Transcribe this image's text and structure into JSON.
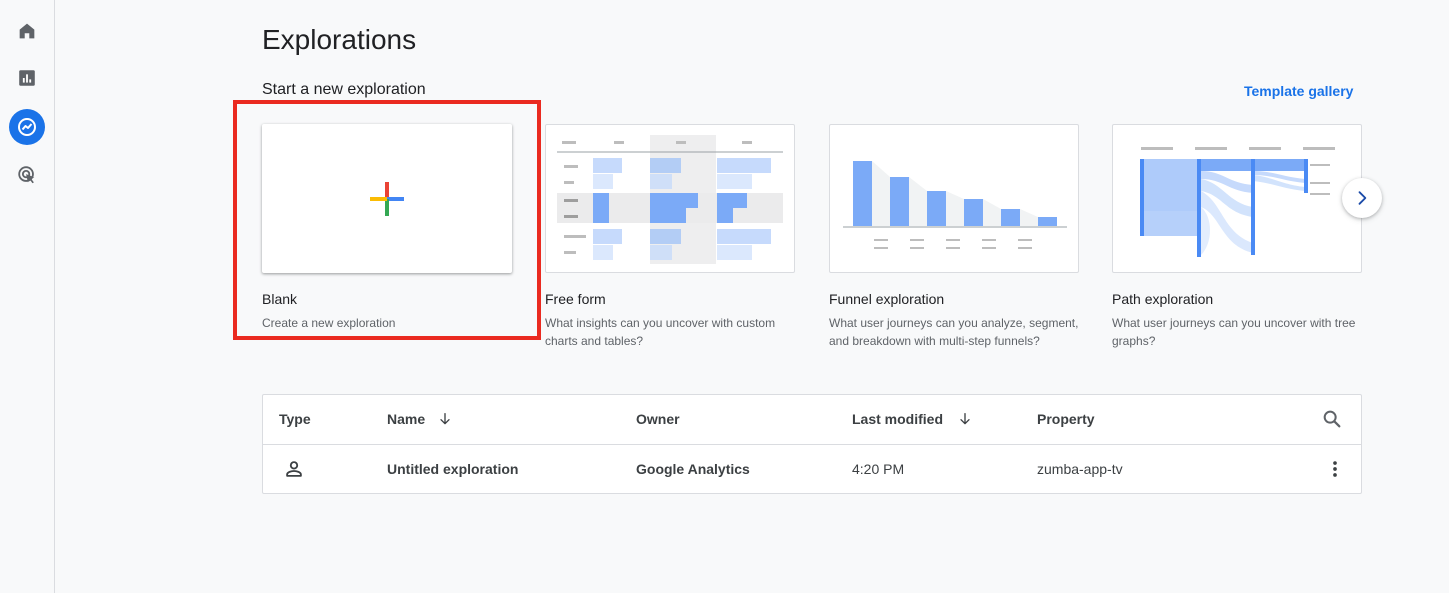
{
  "page": {
    "title": "Explorations",
    "subtitle": "Start a new exploration",
    "template_gallery": "Template gallery"
  },
  "nav": {
    "items": [
      {
        "icon": "home-icon"
      },
      {
        "icon": "reports-icon"
      },
      {
        "icon": "explore-icon",
        "active": true
      },
      {
        "icon": "advertising-icon"
      }
    ]
  },
  "cards": [
    {
      "name": "Blank",
      "desc": "Create a new exploration",
      "highlighted": true
    },
    {
      "name": "Free form",
      "desc": "What insights can you uncover with custom charts and tables?"
    },
    {
      "name": "Funnel exploration",
      "desc": "What user journeys can you analyze, segment, and breakdown with multi-step funnels?"
    },
    {
      "name": "Path exploration",
      "desc": "What user journeys can you uncover with tree graphs?"
    }
  ],
  "table": {
    "headers": {
      "type": "Type",
      "name": "Name",
      "owner": "Owner",
      "last_modified": "Last modified",
      "property": "Property"
    },
    "rows": [
      {
        "type_icon": "person-icon",
        "name": "Untitled exploration",
        "owner": "Google Analytics",
        "last_modified": "4:20 PM",
        "property": "zumba-app-tv"
      }
    ]
  },
  "colors": {
    "accent": "#1a73e8",
    "highlight_box": "#ea2a20",
    "chart_blue": "#7baaf7",
    "chart_light_blue": "#d2e3fc"
  }
}
